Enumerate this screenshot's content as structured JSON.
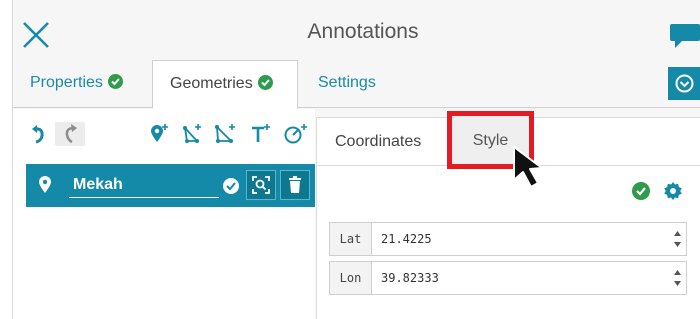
{
  "header": {
    "title": "Annotations",
    "close_icon": "close-icon",
    "chat_icon": "chat-icon"
  },
  "tabs": [
    {
      "label": "Properties",
      "status_icon": "check-circle-icon",
      "active": false
    },
    {
      "label": "Geometries",
      "status_icon": "check-circle-icon",
      "active": true
    },
    {
      "label": "Settings",
      "active": false
    }
  ],
  "download_icon": "download-circle-icon",
  "toolbar": {
    "icons": [
      "undo-icon",
      "redo-icon",
      "add-point-icon",
      "add-line-icon",
      "add-polygon-icon",
      "add-text-icon",
      "add-circle-icon"
    ]
  },
  "geometry_item": {
    "icon": "map-marker-icon",
    "name": "Mekah",
    "actions": [
      "check-circle-icon",
      "zoom-to-icon",
      "trash-icon"
    ]
  },
  "sub_tabs": [
    {
      "label": "Coordinates",
      "active": true
    },
    {
      "label": "Style",
      "active": false,
      "highlighted": true
    }
  ],
  "coordinates": [
    {
      "label": "Lat",
      "value": "21.4225"
    },
    {
      "label": "Lon",
      "value": "39.82333"
    }
  ],
  "colors": {
    "accent": "#148aa8",
    "success": "#2e9c4a",
    "highlight": "#e31b23"
  }
}
